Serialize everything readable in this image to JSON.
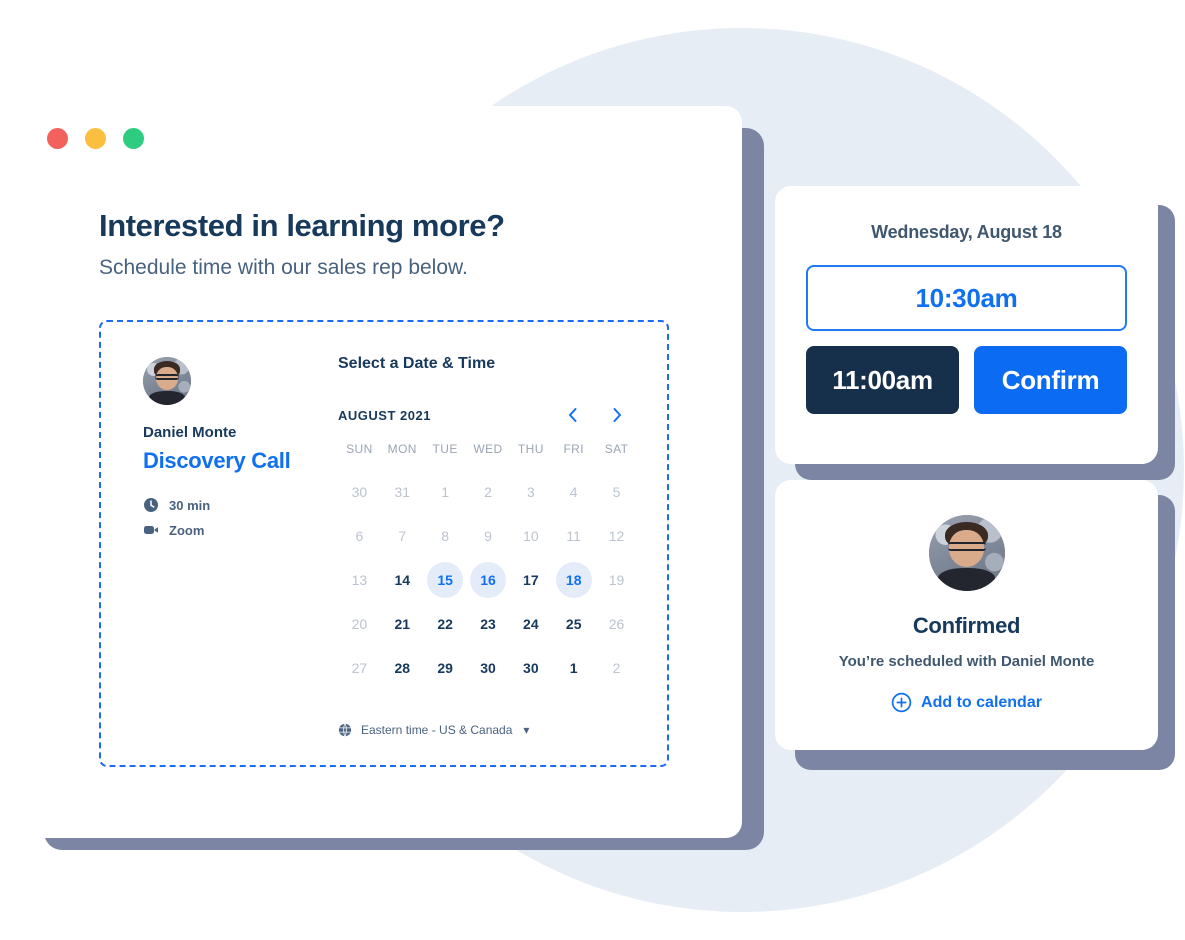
{
  "window": {
    "traffic_lights": [
      {
        "name": "close",
        "color": "#f2615b"
      },
      {
        "name": "minimize",
        "color": "#fbbf3f"
      },
      {
        "name": "maximize",
        "color": "#2ecc80"
      }
    ]
  },
  "page": {
    "title": "Interested in learning more?",
    "subtitle": "Schedule time with our sales rep below."
  },
  "booking": {
    "host": {
      "name": "Daniel Monte",
      "event_title": "Discovery Call",
      "meta": [
        {
          "icon": "clock-icon",
          "label": "30 min"
        },
        {
          "icon": "video-camera-icon",
          "label": "Zoom"
        }
      ]
    },
    "calendar": {
      "heading": "Select a Date & Time",
      "month_label": "AUGUST 2021",
      "prev_label": "‹",
      "next_label": "›",
      "weekdays": [
        "SUN",
        "MON",
        "TUE",
        "WED",
        "THU",
        "FRI",
        "SAT"
      ],
      "days": [
        {
          "n": "30",
          "state": "muted"
        },
        {
          "n": "31",
          "state": "muted"
        },
        {
          "n": "1",
          "state": "muted"
        },
        {
          "n": "2",
          "state": "muted"
        },
        {
          "n": "3",
          "state": "muted"
        },
        {
          "n": "4",
          "state": "muted"
        },
        {
          "n": "5",
          "state": "muted"
        },
        {
          "n": "6",
          "state": "muted"
        },
        {
          "n": "7",
          "state": "muted"
        },
        {
          "n": "8",
          "state": "muted"
        },
        {
          "n": "9",
          "state": "muted"
        },
        {
          "n": "10",
          "state": "muted"
        },
        {
          "n": "11",
          "state": "muted"
        },
        {
          "n": "12",
          "state": "muted"
        },
        {
          "n": "13",
          "state": "muted"
        },
        {
          "n": "14",
          "state": "plain"
        },
        {
          "n": "15",
          "state": "avail"
        },
        {
          "n": "16",
          "state": "avail"
        },
        {
          "n": "17",
          "state": "plain"
        },
        {
          "n": "18",
          "state": "avail"
        },
        {
          "n": "19",
          "state": "muted"
        },
        {
          "n": "20",
          "state": "muted"
        },
        {
          "n": "21",
          "state": "plain"
        },
        {
          "n": "22",
          "state": "plain"
        },
        {
          "n": "23",
          "state": "plain"
        },
        {
          "n": "24",
          "state": "plain"
        },
        {
          "n": "25",
          "state": "plain"
        },
        {
          "n": "26",
          "state": "muted"
        },
        {
          "n": "27",
          "state": "muted"
        },
        {
          "n": "28",
          "state": "plain"
        },
        {
          "n": "29",
          "state": "plain"
        },
        {
          "n": "30",
          "state": "plain"
        },
        {
          "n": "30",
          "state": "plain"
        },
        {
          "n": "1",
          "state": "plain"
        },
        {
          "n": "2",
          "state": "muted"
        }
      ],
      "timezone": "Eastern time - US & Canada",
      "timezone_icon": "globe-icon",
      "timezone_caret": "▾"
    }
  },
  "slots_card": {
    "date_label": "Wednesday, August 18",
    "selected_time": "10:30am",
    "other_time": "11:00am",
    "confirm_label": "Confirm"
  },
  "confirmation_card": {
    "title": "Confirmed",
    "subtitle": "You’re scheduled with Daniel Monte",
    "add_to_calendar": "Add to calendar",
    "add_icon": "plus-circle-icon"
  },
  "colors": {
    "accent_blue": "#0b6bf2",
    "link_blue": "#1170ef",
    "navy": "#16304c",
    "heading_navy": "#17395c",
    "muted_gray": "#bcc4d0",
    "slot_highlight": "#e4ecfa",
    "shadow": "#7c85a3",
    "bg_circle": "#e7edf5"
  }
}
